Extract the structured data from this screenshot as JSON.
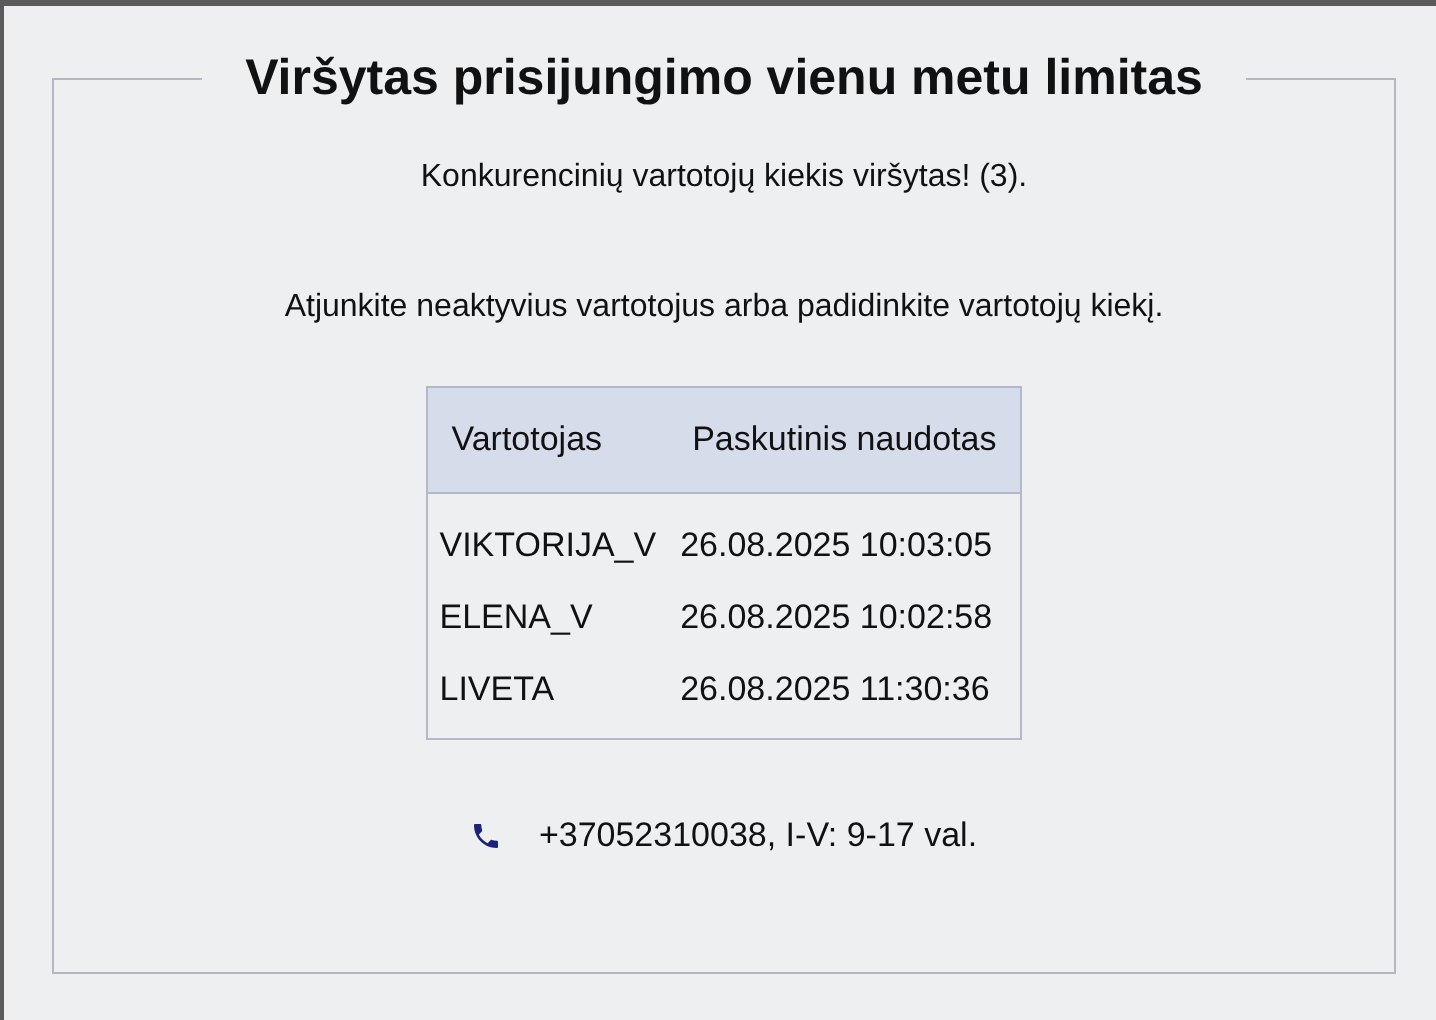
{
  "title": "Viršytas prisijungimo vienu metu limitas",
  "messages": [
    "Konkurencinių vartotojų kiekis viršytas! (3).",
    "Atjunkite neaktyvius vartotojus arba padidinkite vartotojų kiekį."
  ],
  "table": {
    "columns": [
      "Vartotojas",
      "Paskutinis naudotas"
    ],
    "rows": [
      [
        "VIKTORIJA_V",
        "26.08.2025 10:03:05"
      ],
      [
        "ELENA_V",
        "26.08.2025 10:02:58"
      ],
      [
        "LIVETA",
        "26.08.2025 11:30:36"
      ]
    ]
  },
  "contact": "+37052310038, I-V: 9-17 val."
}
